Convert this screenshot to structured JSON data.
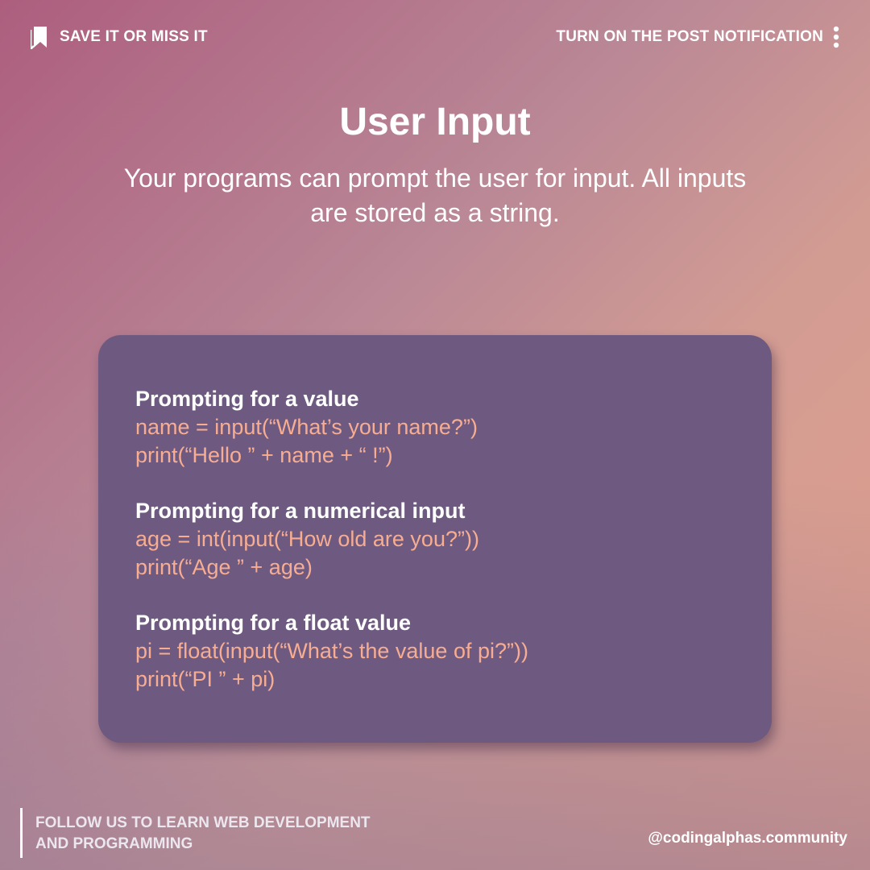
{
  "header": {
    "left_text": "SAVE IT OR MISS IT",
    "left_icon": "bookmark-icon",
    "right_text": "TURN ON THE POST NOTIFICATION",
    "right_icon": "more-vertical-icon"
  },
  "title": "User Input",
  "subtitle": "Your programs can prompt the user for input. All inputs are stored as a string.",
  "card": {
    "background": "#6e5a80",
    "code_color": "#f7ad92",
    "blocks": [
      {
        "heading": "Prompting for a value",
        "lines": [
          "name = input(“What’s your name?”)",
          "print(“Hello ” + name + “ !”)"
        ]
      },
      {
        "heading": "Prompting for a numerical input",
        "lines": [
          "age = int(input(“How old are you?”))",
          "print(“Age ” + age)"
        ]
      },
      {
        "heading": "Prompting for a float value",
        "lines": [
          "pi = float(input(“What’s the value of pi?”))",
          "print(“PI ” + pi)"
        ]
      }
    ]
  },
  "footer": {
    "line1": "FOLLOW US TO LEARN WEB DEVELOPMENT",
    "line2": "AND PROGRAMMING",
    "handle": "@codingalphas.community"
  }
}
